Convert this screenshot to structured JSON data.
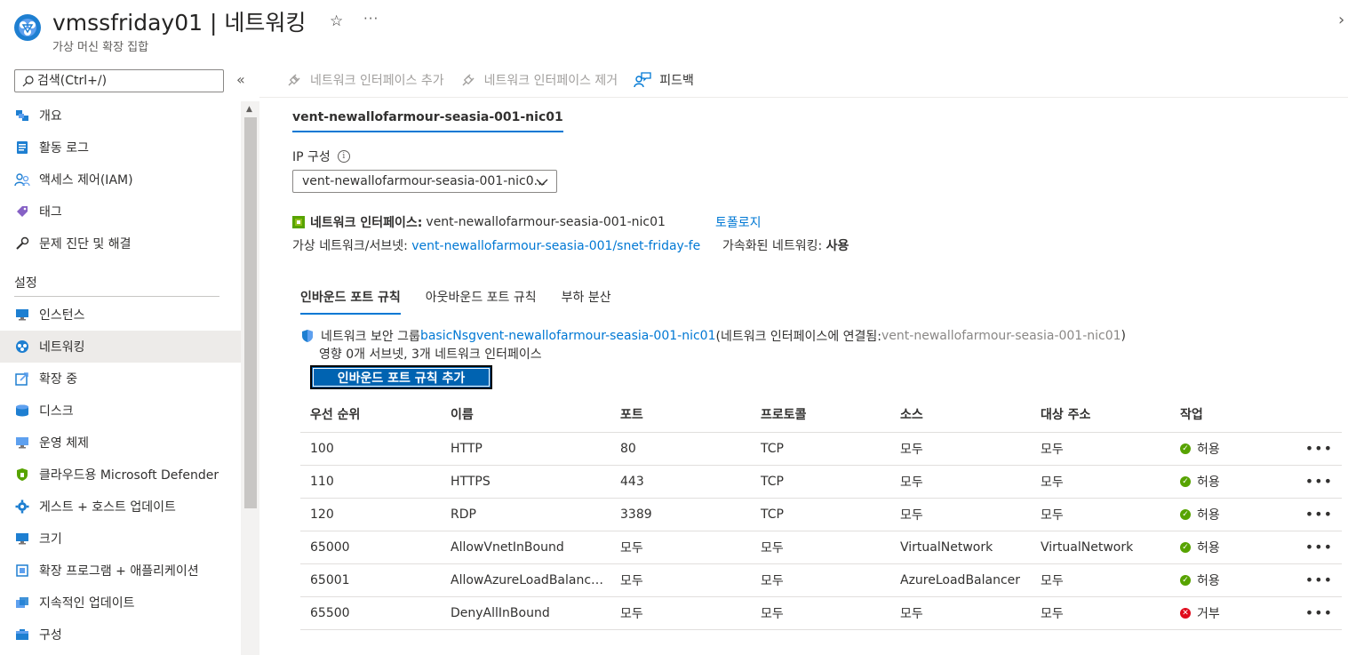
{
  "header": {
    "title": "vmssfriday01 | 네트워킹",
    "subtitle": "가상 머신 확장 집합",
    "star_icon": "star-icon",
    "more_label": "···",
    "close_label": "›"
  },
  "sidebar": {
    "search_placeholder": "검색(Ctrl+/)",
    "collapse_label": "«",
    "items_top": [
      {
        "label": "개요",
        "icon": "overview-icon"
      },
      {
        "label": "활동 로그",
        "icon": "activity-log-icon"
      },
      {
        "label": "액세스 제어(IAM)",
        "icon": "iam-icon"
      },
      {
        "label": "태그",
        "icon": "tag-icon"
      },
      {
        "label": "문제 진단 및 해결",
        "icon": "wrench-icon"
      }
    ],
    "section_settings": "설정",
    "items_settings": [
      {
        "label": "인스턴스",
        "icon": "monitor-icon"
      },
      {
        "label": "네트워킹",
        "icon": "network-icon",
        "active": true
      },
      {
        "label": "확장 중",
        "icon": "scaling-icon"
      },
      {
        "label": "디스크",
        "icon": "disk-icon"
      },
      {
        "label": "운영 체제",
        "icon": "os-icon"
      },
      {
        "label": "클라우드용 Microsoft Defender",
        "icon": "defender-shield-icon"
      },
      {
        "label": "게스트 + 호스트 업데이트",
        "icon": "gear-icon"
      },
      {
        "label": "크기",
        "icon": "size-icon"
      },
      {
        "label": "확장 프로그램 + 애플리케이션",
        "icon": "extensions-icon"
      },
      {
        "label": "지속적인 업데이트",
        "icon": "continuous-update-icon"
      },
      {
        "label": "구성",
        "icon": "configuration-icon"
      }
    ]
  },
  "toolbar": {
    "add_nic_label": "네트워크 인터페이스 추가",
    "remove_nic_label": "네트워크 인터페이스 제거",
    "feedback_label": "피드백"
  },
  "nic": {
    "tab_label": "vent-newallofarmour-seasia-001-nic01",
    "ip_config_label": "IP 구성",
    "ip_config_value": "vent-newallofarmour-seasia-001-nic0...",
    "interface_key": "네트워크 인터페이스:",
    "interface_value": "vent-newallofarmour-seasia-001-nic01",
    "topology_link": "토폴로지",
    "vnet_key": "가상 네트워크/서브넷: ",
    "vnet_value": "vent-newallofarmour-seasia-001/snet-friday-fe",
    "accel_key": "가속화된 네트워킹: ",
    "accel_value": "사용"
  },
  "rule_tabs": [
    "인바운드 포트 규칙",
    "아웃바운드 포트 규칙",
    "부하 분산"
  ],
  "nsg": {
    "prefix": "네트워크 보안 그룹 ",
    "name": "basicNsgvent-newallofarmour-seasia-001-nic01",
    "attached_prefix": " (네트워크 인터페이스에 연결됨: ",
    "attached_value": "vent-newallofarmour-seasia-001-nic01",
    "attached_suffix": ")",
    "impact": "영향 0개 서브넷, 3개 네트워크 인터페이스",
    "add_button": "인바운드 포트 규칙 추가"
  },
  "table": {
    "headers": [
      "우선 순위",
      "이름",
      "포트",
      "프로토콜",
      "소스",
      "대상 주소",
      "작업"
    ],
    "rows": [
      {
        "priority": "100",
        "name": "HTTP",
        "port": "80",
        "protocol": "TCP",
        "source": "모두",
        "dest": "모두",
        "action": "허용",
        "allow": true
      },
      {
        "priority": "110",
        "name": "HTTPS",
        "port": "443",
        "protocol": "TCP",
        "source": "모두",
        "dest": "모두",
        "action": "허용",
        "allow": true
      },
      {
        "priority": "120",
        "name": "RDP",
        "port": "3389",
        "protocol": "TCP",
        "source": "모두",
        "dest": "모두",
        "action": "허용",
        "allow": true
      },
      {
        "priority": "65000",
        "name": "AllowVnetInBound",
        "port": "모두",
        "protocol": "모두",
        "source": "VirtualNetwork",
        "dest": "VirtualNetwork",
        "action": "허용",
        "allow": true
      },
      {
        "priority": "65001",
        "name": "AllowAzureLoadBalancerI...",
        "port": "모두",
        "protocol": "모두",
        "source": "AzureLoadBalancer",
        "dest": "모두",
        "action": "허용",
        "allow": true
      },
      {
        "priority": "65500",
        "name": "DenyAllInBound",
        "port": "모두",
        "protocol": "모두",
        "source": "모두",
        "dest": "모두",
        "action": "거부",
        "allow": false
      }
    ],
    "more_label": "•••"
  },
  "colors": {
    "accent": "#0078d4",
    "allow": "#57a300",
    "deny": "#e00b1c",
    "active_bg": "#edebe9"
  }
}
